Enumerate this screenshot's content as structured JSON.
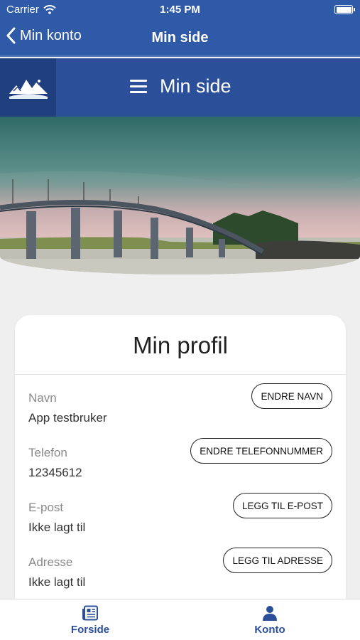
{
  "status_bar": {
    "carrier": "Carrier",
    "time": "1:45 PM"
  },
  "nav": {
    "back_label": "Min konto",
    "title": "Min side"
  },
  "header": {
    "title": "Min side"
  },
  "profile": {
    "title": "Min profil",
    "fields": [
      {
        "label": "Navn",
        "value": "App testbruker",
        "button": "ENDRE NAVN"
      },
      {
        "label": "Telefon",
        "value": "12345612",
        "button": "ENDRE TELEFONNUMMER"
      },
      {
        "label": "E-post",
        "value": "Ikke lagt til",
        "button": "LEGG TIL E-POST"
      },
      {
        "label": "Adresse",
        "value": "Ikke lagt til",
        "button": "LEGG TIL ADRESSE"
      }
    ]
  },
  "tabs": [
    {
      "label": "Forside",
      "icon": "newspaper-icon"
    },
    {
      "label": "Konto",
      "icon": "person-icon"
    }
  ],
  "colors": {
    "primary": "#2f5aa8",
    "header": "#2b4f99",
    "tab_active": "#2b4f99"
  }
}
